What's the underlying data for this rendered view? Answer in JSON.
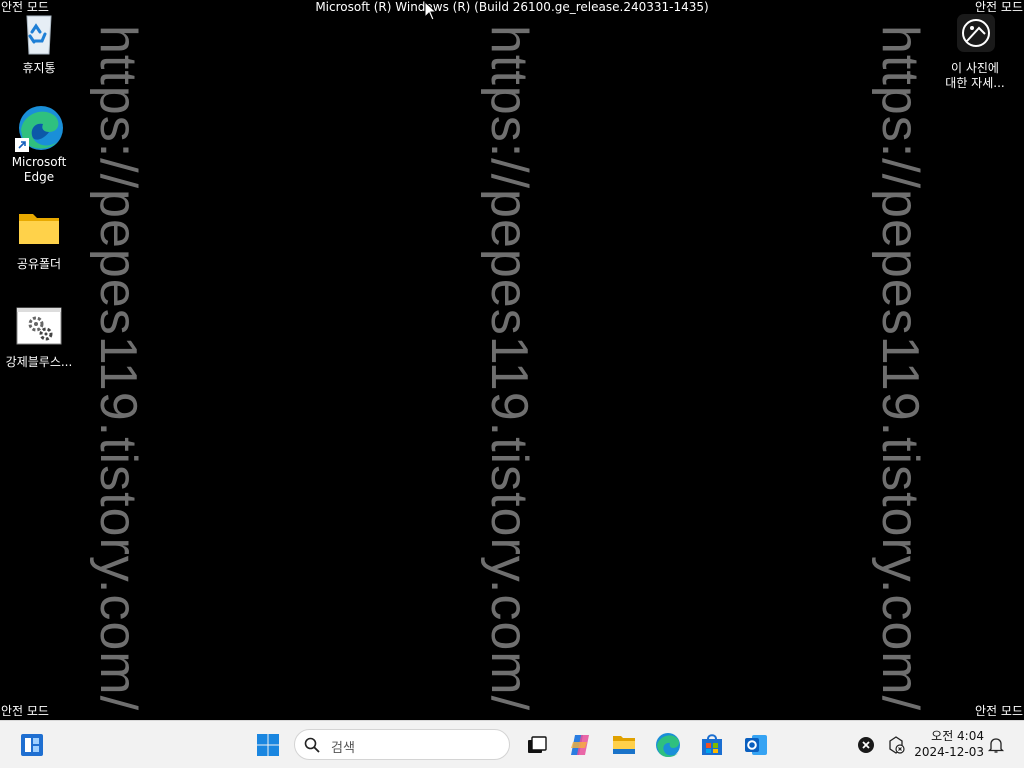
{
  "desktop": {
    "safe_mode_label": "안전 모드",
    "build_label": "Microsoft (R) Windows (R) (Build 26100.ge_release.240331-1435)",
    "watermark": "https://pepes119.tistory.com/",
    "icons": {
      "recycle_bin": "휴지통",
      "edge": "Microsoft Edge",
      "shared_folder": "공유폴더",
      "force_bluescreen": "강제블루스...",
      "about_photo_line1": "이 사진에",
      "about_photo_line2": "대한 자세..."
    }
  },
  "taskbar": {
    "search_placeholder": "검색",
    "clock_time": "오전 4:04",
    "clock_date": "2024-12-03",
    "icons": [
      "widgets-icon",
      "start-icon",
      "search-icon",
      "task-view-icon",
      "copilot-icon",
      "file-explorer-icon",
      "edge-icon",
      "store-icon",
      "outlook-icon",
      "close-circle-icon",
      "network-disconnected-icon",
      "notification-bell-icon"
    ]
  },
  "colors": {
    "desktop_bg": "#000000",
    "watermark": "#6f6f6f",
    "taskbar_bg": "#f2f2f2",
    "accent_blue": "#0a67d8"
  }
}
